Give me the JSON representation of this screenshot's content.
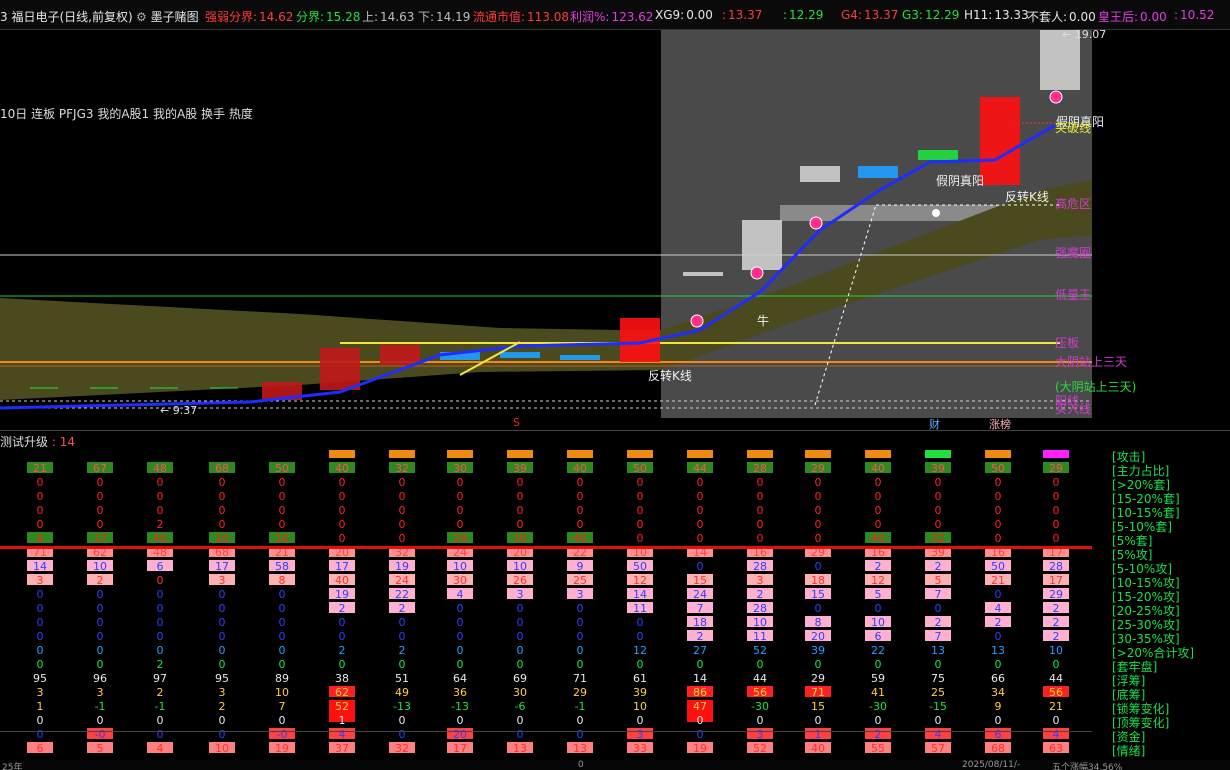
{
  "topbar": {
    "items": [
      {
        "label": "3 福日电子(日线,前复权)",
        "value": "",
        "color": "#e6e6e6"
      },
      {
        "label": "墨子赌图",
        "value": "",
        "color": "#e6e6e6",
        "icon": "gear-icon"
      },
      {
        "label": "强弱分界:",
        "value": "14.62",
        "color": "#ff3b3b"
      },
      {
        "label": "分界:",
        "value": "15.28",
        "color": "#25e03a"
      },
      {
        "label": "上:",
        "value": "14.63",
        "color": "#bdbdbd"
      },
      {
        "label": "下:",
        "value": "14.19",
        "color": "#bdbdbd"
      },
      {
        "label": "流通市值:",
        "value": "113.08",
        "color": "#ff3b3b"
      },
      {
        "label": "利润%:",
        "value": "123.62",
        "color": "#e23ce2"
      },
      {
        "label": "XG9:",
        "value": "0.00",
        "color": "#e6e6e6"
      },
      {
        "label": ":",
        "value": "13.37",
        "color": "#ff3b3b"
      },
      {
        "label": ":",
        "value": "12.29",
        "color": "#25e03a"
      },
      {
        "label": "G4:",
        "value": "13.37",
        "color": "#ff3b3b"
      },
      {
        "label": "G3:",
        "value": "12.29",
        "color": "#25e03a"
      },
      {
        "label": "H11:",
        "value": "13.33",
        "color": "#e6e6e6"
      },
      {
        "label": "不套人:",
        "value": "0.00",
        "color": "#e6e6e6"
      },
      {
        "label": "皇王后:",
        "value": "0.00",
        "color": "#e23ce2"
      },
      {
        "label": ":",
        "value": "10.52",
        "color": "#e23ce2"
      },
      {
        "label": "皇王后线:",
        "value": "",
        "color": "#e23ce2"
      }
    ]
  },
  "chart": {
    "legend_line": "10日 连板 PFJG3 我的A股1 我的A股 换手 热度",
    "price_high": "19.07",
    "price_low": "9.37",
    "annotations": {
      "fan_k1": "反转K线",
      "fan_k2": "反转K线",
      "jia_yin_1": "假阴真阳",
      "jia_yin_2": "假阴真阳",
      "niu": "牛",
      "tupo": "突破线",
      "dayin": "(大阴站上三天)"
    },
    "right_labels": [
      {
        "text": "突破线",
        "color": "#e9e93a"
      },
      {
        "text": "高危区",
        "color": "#d23cd2"
      },
      {
        "text": "强魔圈",
        "color": "#d23cd2"
      },
      {
        "text": "低量王",
        "color": "#d23cd2"
      },
      {
        "text": "压板",
        "color": "#d23cd2"
      },
      {
        "text": "大阴站上三天",
        "color": "#d23cd2"
      },
      {
        "text": "(大阴站上三天)",
        "color": "#25e03a"
      },
      {
        "text": "阳线",
        "color": "#d23cd2"
      },
      {
        "text": "买入线",
        "color": "#d23cd2"
      }
    ],
    "markers": {
      "cai": "财",
      "zhang": "涨榜",
      "s": "S"
    }
  },
  "indicator": {
    "title": "测试升级",
    "value": "14",
    "row_labels": [
      "[攻击]",
      "[主力占比]",
      "[>20%套]",
      "[15-20%套]",
      "[10-15%套]",
      "[5-10%套]",
      "[5%套]",
      "[5%攻]",
      "[5-10%攻]",
      "[10-15%攻]",
      "[15-20%攻]",
      "[20-25%攻]",
      "[25-30%攻]",
      "[30-35%攻]",
      "[>20%合计攻]",
      "[套牢盘]",
      "[浮筹]",
      "[底筹]",
      "[锁筹变化]",
      "[顶筹变化]",
      "[资金]",
      "[情绪]"
    ],
    "columns": 18,
    "rows": [
      {
        "key": "attack",
        "values": [
          "",
          "",
          "",
          "",
          "",
          "",
          "",
          "",
          "",
          "",
          "",
          "",
          "",
          "",
          "",
          "",
          "",
          ""
        ]
      },
      {
        "key": "zhuli",
        "values": [
          "21",
          "67",
          "48",
          "68",
          "50",
          "40",
          "32",
          "30",
          "39",
          "40",
          "50",
          "44",
          "28",
          "29",
          "40",
          "39",
          "50",
          "29"
        ]
      },
      {
        "key": "t20",
        "values": [
          "0",
          "0",
          "0",
          "0",
          "0",
          "0",
          "0",
          "0",
          "0",
          "0",
          "0",
          "0",
          "0",
          "0",
          "0",
          "0",
          "0",
          "0"
        ]
      },
      {
        "key": "t15",
        "values": [
          "0",
          "0",
          "0",
          "0",
          "0",
          "0",
          "0",
          "0",
          "0",
          "0",
          "0",
          "0",
          "0",
          "0",
          "0",
          "0",
          "0",
          "0"
        ]
      },
      {
        "key": "t10",
        "values": [
          "0",
          "0",
          "0",
          "0",
          "0",
          "0",
          "0",
          "0",
          "0",
          "0",
          "0",
          "0",
          "0",
          "0",
          "0",
          "0",
          "0",
          "0"
        ]
      },
      {
        "key": "t5_10",
        "values": [
          "0",
          "0",
          "2",
          "0",
          "0",
          "0",
          "0",
          "0",
          "0",
          "0",
          "0",
          "0",
          "0",
          "0",
          "0",
          "0",
          "0",
          "0"
        ]
      },
      {
        "key": "t5",
        "values": [
          "9",
          "17",
          "40",
          "10",
          "10",
          "0",
          "0",
          "29",
          "30",
          "40",
          "0",
          "0",
          "0",
          "0",
          "40",
          "32",
          "0",
          "0"
        ]
      },
      {
        "key": "g5",
        "values": [
          "71",
          "62",
          "48",
          "68",
          "21",
          "20",
          "32",
          "24",
          "20",
          "22",
          "10",
          "14",
          "16",
          "29",
          "16",
          "39",
          "16",
          "17"
        ]
      },
      {
        "key": "g5_10",
        "values": [
          "14",
          "10",
          "6",
          "17",
          "58",
          "17",
          "19",
          "10",
          "10",
          "9",
          "50",
          "0",
          "28",
          "0",
          "2",
          "2",
          "50",
          "28"
        ]
      },
      {
        "key": "g10_15",
        "values": [
          "3",
          "2",
          "0",
          "3",
          "8",
          "40",
          "24",
          "30",
          "26",
          "25",
          "12",
          "15",
          "3",
          "18",
          "12",
          "5",
          "21",
          "17"
        ]
      },
      {
        "key": "g15_20",
        "values": [
          "0",
          "0",
          "0",
          "0",
          "0",
          "19",
          "22",
          "4",
          "3",
          "3",
          "14",
          "24",
          "2",
          "15",
          "5",
          "7",
          "0",
          "29"
        ]
      },
      {
        "key": "g20_25",
        "values": [
          "0",
          "0",
          "0",
          "0",
          "0",
          "2",
          "2",
          "0",
          "0",
          "0",
          "11",
          "7",
          "28",
          "0",
          "0",
          "0",
          "4",
          "2"
        ]
      },
      {
        "key": "g25_30",
        "values": [
          "0",
          "0",
          "0",
          "0",
          "0",
          "0",
          "0",
          "0",
          "0",
          "0",
          "0",
          "18",
          "10",
          "8",
          "10",
          "2",
          "2",
          "2"
        ]
      },
      {
        "key": "g30_35",
        "values": [
          "0",
          "0",
          "0",
          "0",
          "0",
          "0",
          "0",
          "0",
          "0",
          "0",
          "0",
          "2",
          "11",
          "20",
          "6",
          "7",
          "0",
          "2"
        ]
      },
      {
        "key": "g20sum",
        "values": [
          "0",
          "0",
          "0",
          "0",
          "0",
          "2",
          "2",
          "0",
          "0",
          "0",
          "12",
          "27",
          "52",
          "39",
          "22",
          "13",
          "13",
          "10"
        ]
      },
      {
        "key": "taolao",
        "values": [
          "0",
          "0",
          "2",
          "0",
          "0",
          "0",
          "0",
          "0",
          "0",
          "0",
          "0",
          "0",
          "0",
          "0",
          "0",
          "0",
          "0",
          "0"
        ]
      },
      {
        "key": "fuchou",
        "values": [
          "95",
          "96",
          "97",
          "95",
          "89",
          "38",
          "51",
          "64",
          "69",
          "71",
          "61",
          "14",
          "44",
          "29",
          "59",
          "75",
          "66",
          "44"
        ]
      },
      {
        "key": "dichou",
        "values": [
          "3",
          "3",
          "2",
          "3",
          "10",
          "62",
          "49",
          "36",
          "30",
          "29",
          "39",
          "86",
          "56",
          "71",
          "41",
          "25",
          "34",
          "56"
        ]
      },
      {
        "key": "suochou",
        "values": [
          "1",
          "-1",
          "-1",
          "2",
          "7",
          "52",
          "-13",
          "-13",
          "-6",
          "-1",
          "10",
          "47",
          "-30",
          "15",
          "-30",
          "-15",
          "9",
          "21"
        ]
      },
      {
        "key": "dingchou",
        "values": [
          "0",
          "0",
          "0",
          "0",
          "0",
          "1",
          "0",
          "0",
          "0",
          "0",
          "0",
          "0",
          "0",
          "0",
          "0",
          "0",
          "0",
          "0"
        ]
      },
      {
        "key": "zijin",
        "values": [
          "0",
          "-0",
          "0",
          "0",
          "-0",
          "4",
          "0",
          "20",
          "0",
          "0",
          "3",
          "0",
          "3",
          "1",
          "2",
          "4",
          "6",
          "4"
        ]
      },
      {
        "key": "qingxu",
        "values": [
          "6",
          "5",
          "4",
          "10",
          "19",
          "37",
          "32",
          "17",
          "13",
          "13",
          "33",
          "19",
          "52",
          "40",
          "55",
          "57",
          "68",
          "63"
        ]
      }
    ]
  },
  "bottombar": {
    "left": "25年",
    "mid": "0",
    "date": "2025/08/11/-",
    "right": "五个涨幅34.56%"
  },
  "colors": {
    "red": "#ff2020",
    "green": "#20e040",
    "blue": "#1e2cff",
    "magenta": "#e23ce2",
    "yellow": "#f2e63a",
    "orange": "#f08a10"
  }
}
